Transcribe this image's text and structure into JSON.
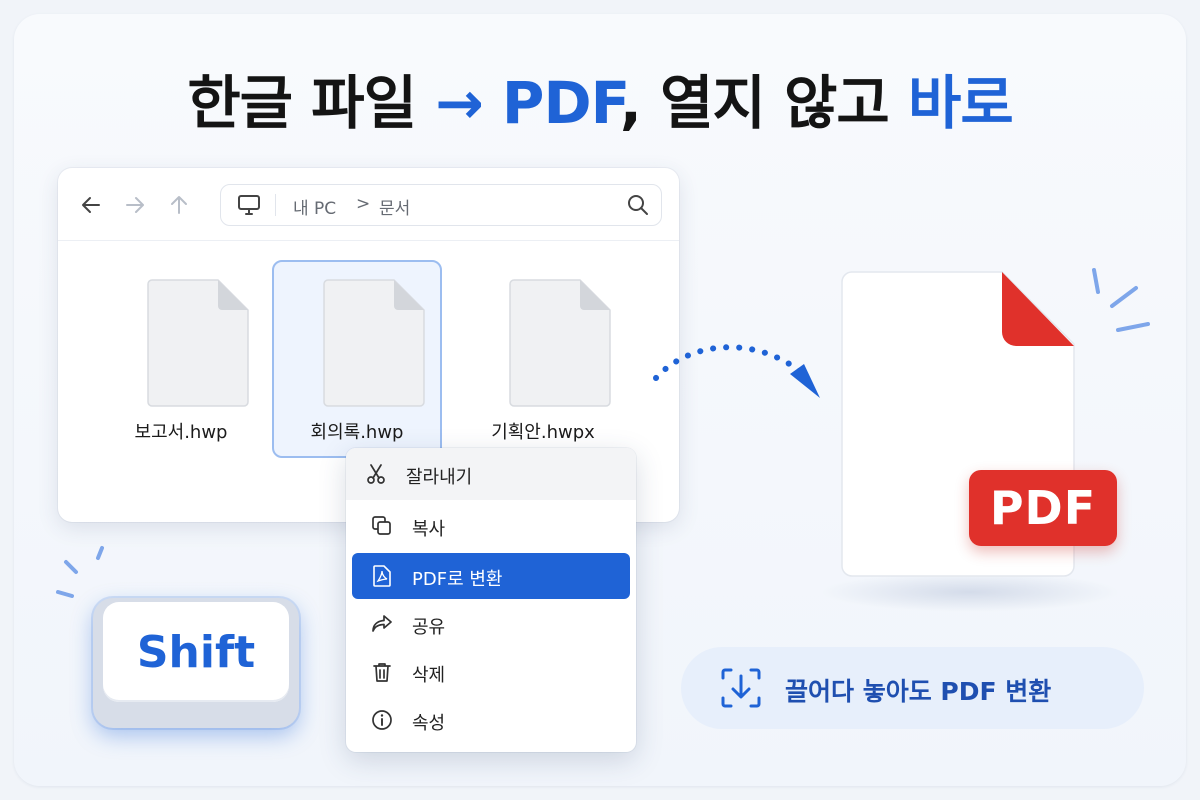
{
  "headline": {
    "part1": "한글 파일 ",
    "arrow": "→ PDF",
    "part2": ", 열지 않고 ",
    "part3": "바로"
  },
  "colors": {
    "accent": "#1f63d6",
    "pdf_red": "#e0312b",
    "text_dark": "#141414",
    "menu_highlight": "#1f63d6"
  },
  "explorer": {
    "nav_icons": [
      "back-arrow-icon",
      "forward-arrow-icon",
      "up-arrow-icon"
    ],
    "breadcrumb": [
      "내 PC",
      "문서"
    ],
    "breadcrumb_separator": ">",
    "files": [
      {
        "name": "보고서.hwp",
        "selected": false
      },
      {
        "name": "회의록.hwp",
        "selected": true
      },
      {
        "name": "기획안.hwpx",
        "selected": false
      }
    ]
  },
  "context_menu": {
    "items": [
      {
        "label": "잘라내기",
        "icon": "scissors-icon"
      },
      {
        "label": "복사",
        "icon": "copy-icon"
      },
      {
        "label": "PDF로 변환",
        "icon": "pdf-file-icon",
        "highlighted": true
      },
      {
        "label": "공유",
        "icon": "share-icon"
      },
      {
        "label": "삭제",
        "icon": "trash-icon"
      },
      {
        "label": "속성",
        "icon": "info-icon"
      }
    ]
  },
  "shift_key": {
    "label": "Shift"
  },
  "pdf_document": {
    "badge": "PDF"
  },
  "drag_pill": {
    "text": "끌어다 놓아도 PDF 변환",
    "icon": "download-drop-icon"
  }
}
